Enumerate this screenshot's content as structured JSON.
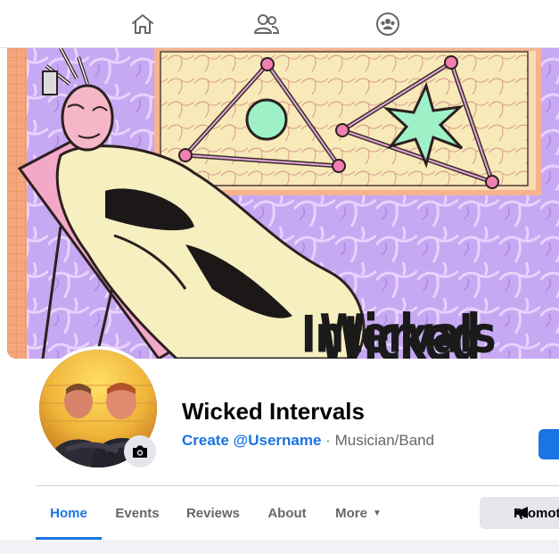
{
  "nav": {
    "icons": [
      "home-icon",
      "friends-icon",
      "groups-icon"
    ]
  },
  "page": {
    "name": "Wicked Intervals",
    "username_cta": "Create @Username",
    "separator": "·",
    "category": "Musician/Band"
  },
  "cover": {
    "art_text_line1": "Wicked",
    "art_text_line2": "Intervals"
  },
  "tabs": [
    {
      "label": "Home",
      "active": true
    },
    {
      "label": "Events"
    },
    {
      "label": "Reviews"
    },
    {
      "label": "About"
    },
    {
      "label": "More"
    }
  ],
  "actions": {
    "promote_label": "Promote"
  },
  "colors": {
    "accent": "#1b74e4",
    "text_primary": "#050505",
    "text_secondary": "#65676b",
    "button_gray": "#e4e6eb"
  }
}
